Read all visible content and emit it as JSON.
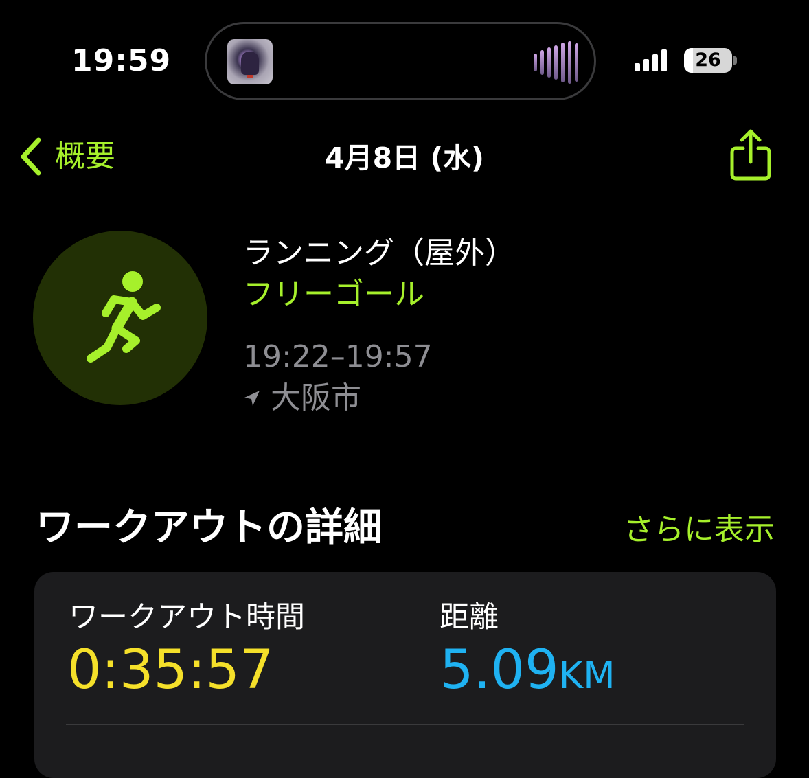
{
  "status_bar": {
    "time": "19:59",
    "battery": "26"
  },
  "nav": {
    "back_label": "概要",
    "title": "4月8日 (水)"
  },
  "workout": {
    "type": "ランニング（屋外）",
    "goal": "フリーゴール",
    "time_range": "19:22–19:57",
    "location": "大阪市"
  },
  "section": {
    "title": "ワークアウトの詳細",
    "more_label": "さらに表示"
  },
  "metrics": [
    {
      "label": "ワークアウト時間",
      "value": "0:35:57",
      "unit": ""
    },
    {
      "label": "距離",
      "value": "5.09",
      "unit": "KM"
    }
  ],
  "colors": {
    "accent": "#a6f02b",
    "duration": "#f5e02a",
    "distance": "#1fb2f2",
    "icon_bg": "#223005",
    "card_bg": "#1c1c1e"
  }
}
